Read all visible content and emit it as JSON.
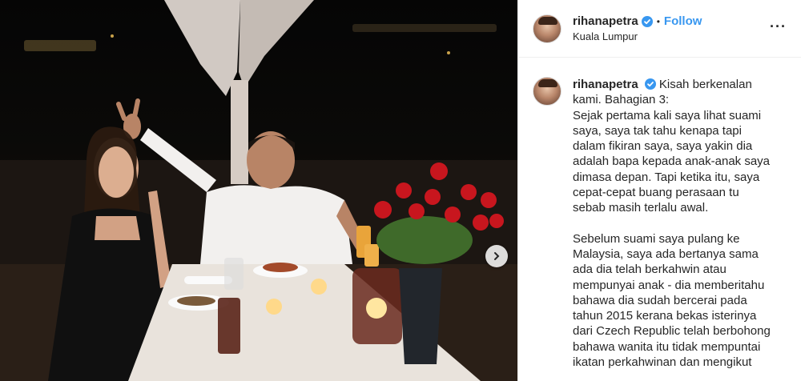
{
  "post": {
    "username": "rihanapetra",
    "follow_label": "Follow",
    "separator": "•",
    "location": "Kuala Lumpur",
    "more_label": "···",
    "caption_lead": "Kisah berkenalan kami. Bahagian 3:",
    "caption_p1": "Sejak pertama kali saya lihat suami saya, saya tak tahu kenapa tapi dalam fikiran saya, saya yakin dia adalah bapa kepada anak-anak saya dimasa depan. Tapi ketika itu, saya cepat-cepat buang perasaan tu sebab masih terlalu awal.",
    "caption_p2": "Sebelum suami saya pulang ke Malaysia, saya ada bertanya sama ada dia telah berkahwin atau mempunyai anak - dia memberitahu bahawa dia sudah bercerai pada tahun 2015 kerana bekas isterinya dari Czech Republic telah berbohong bahawa wanita itu tidak mempuntai ikatan perkahwinan dan mengikut"
  },
  "icons": {
    "verified": "verified-badge-icon",
    "next": "chevron-right-icon"
  },
  "colors": {
    "follow": "#3897f0",
    "verified": "#3897f0",
    "text": "#262626"
  }
}
